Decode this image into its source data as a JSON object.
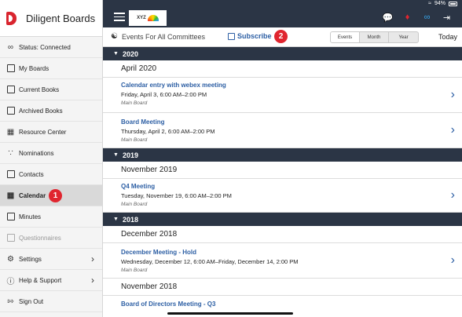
{
  "status": {
    "battery": "94%"
  },
  "brand": {
    "name": "Diligent Boards"
  },
  "sidebar": {
    "items": [
      {
        "label": "Status: Connected",
        "icon": "infinity-icon"
      },
      {
        "label": "My Boards",
        "icon": "square-icon"
      },
      {
        "label": "Current Books",
        "icon": "book-icon"
      },
      {
        "label": "Archived Books",
        "icon": "archive-icon"
      },
      {
        "label": "Resource Center",
        "icon": "resource-icon"
      },
      {
        "label": "Nominations",
        "icon": "nominations-icon"
      },
      {
        "label": "Contacts",
        "icon": "contacts-icon"
      },
      {
        "label": "Calendar",
        "icon": "calendar-icon"
      },
      {
        "label": "Minutes",
        "icon": "minutes-icon"
      },
      {
        "label": "Questionnaires",
        "icon": "questionnaire-icon"
      },
      {
        "label": "Settings",
        "icon": "gear-icon"
      },
      {
        "label": "Help & Support",
        "icon": "help-icon"
      },
      {
        "label": "Sign Out",
        "icon": "sign-out-icon"
      }
    ]
  },
  "callouts": {
    "one": "1",
    "two": "2"
  },
  "topbar": {
    "logo_text": "XYZ"
  },
  "subheader": {
    "committees_label": "Events For All Committees",
    "subscribe_label": "Subscribe",
    "segments": [
      "Events",
      "Month",
      "Year"
    ],
    "selected_segment": "Events",
    "today_label": "Today"
  },
  "calendar": {
    "y2020": "2020",
    "y2019": "2019",
    "y2018": "2018",
    "m_apr2020": "April 2020",
    "m_nov2019": "November 2019",
    "m_dec2018": "December 2018",
    "m_nov2018": "November 2018",
    "events": [
      {
        "title": "Calendar entry with webex meeting",
        "date": "Friday, April 3, 6:00 AM–2:00 PM",
        "board": "Main Board"
      },
      {
        "title": "Board Meeting",
        "date": "Thursday, April 2, 6:00 AM–2:00 PM",
        "board": "Main Board"
      },
      {
        "title": "Q4 Meeting",
        "date": "Tuesday, November 19, 6:00 AM–2:00 PM",
        "board": "Main Board"
      },
      {
        "title": "December Meeting - Hold",
        "date": "Wednesday, December 12, 6:00 AM–Friday, December 14, 2:00 PM",
        "board": "Main Board"
      },
      {
        "title": "Board of Directors Meeting - Q3",
        "date": "",
        "board": ""
      }
    ]
  },
  "colors": {
    "navy": "#2b3545",
    "link": "#2d5fa4",
    "badge": "#e0252f"
  }
}
